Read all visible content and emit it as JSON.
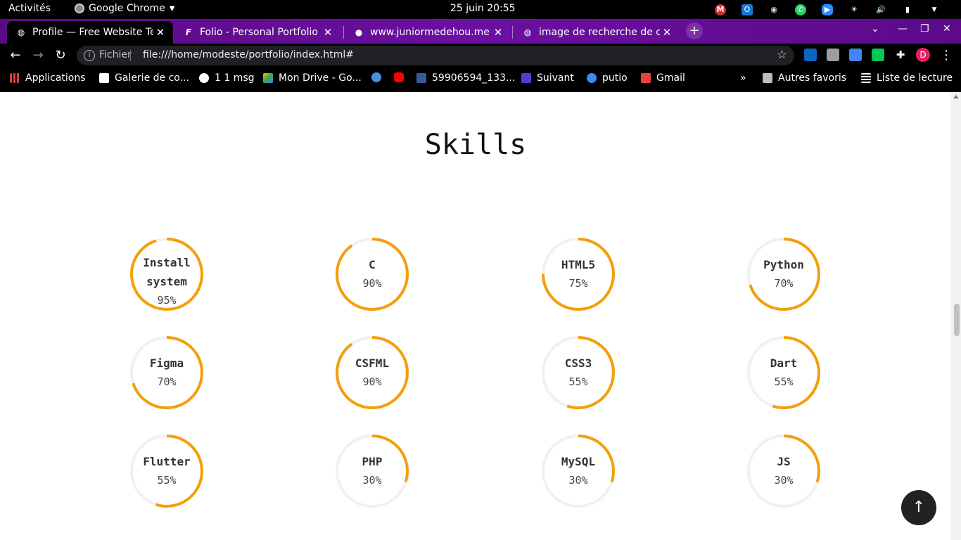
{
  "topbar": {
    "activities": "Activités",
    "app": "Google Chrome",
    "clock": "25 juin  20:55"
  },
  "tabs": [
    {
      "title": "Profile — Free Website Te",
      "active": true
    },
    {
      "title": "Folio - Personal Portfolio",
      "active": false
    },
    {
      "title": "www.juniormedehou.me",
      "active": false
    },
    {
      "title": "image de recherche de ch",
      "active": false
    }
  ],
  "omnibox": {
    "scheme": "Fichier",
    "url": "file:///home/modeste/portfolio/index.html#"
  },
  "bookmarks": [
    {
      "label": "Applications",
      "color": "#e53935"
    },
    {
      "label": "Galerie de co...",
      "color": "#ffffff"
    },
    {
      "label": "1 1 msg",
      "color": "#ffffff"
    },
    {
      "label": "Mon Drive - Go...",
      "color": "#34a853"
    },
    {
      "label": "",
      "color": "#4a90e2"
    },
    {
      "label": "",
      "color": "#ff0000"
    },
    {
      "label": "59906594_133...",
      "color": "#3b5998"
    },
    {
      "label": "Suivant",
      "color": "#4b3fd1"
    },
    {
      "label": "putio",
      "color": "#4285f4"
    },
    {
      "label": "Gmail",
      "color": "#ea4335"
    }
  ],
  "bookmarks_right": {
    "more": "»",
    "other": "Autres favoris",
    "reading": "Liste de lecture"
  },
  "page": {
    "title": "Skills",
    "accent": "#f59e0b",
    "track": "#f1f1f1"
  },
  "skills": [
    {
      "name": "Install system",
      "percent": 95
    },
    {
      "name": "C",
      "percent": 90
    },
    {
      "name": "HTML5",
      "percent": 75
    },
    {
      "name": "Python",
      "percent": 70
    },
    {
      "name": "Figma",
      "percent": 70
    },
    {
      "name": "CSFML",
      "percent": 90
    },
    {
      "name": "CSS3",
      "percent": 55
    },
    {
      "name": "Dart",
      "percent": 55
    },
    {
      "name": "Flutter",
      "percent": 55
    },
    {
      "name": "PHP",
      "percent": 30
    },
    {
      "name": "MySQL",
      "percent": 30
    },
    {
      "name": "JS",
      "percent": 30
    }
  ]
}
